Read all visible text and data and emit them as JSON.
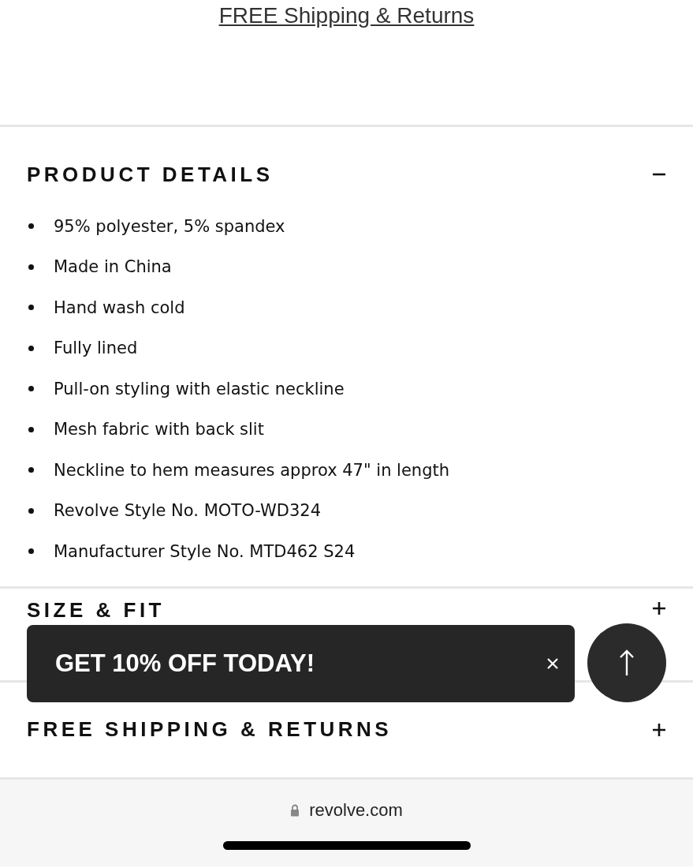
{
  "shipping_link": "FREE Shipping & Returns",
  "sections": [
    {
      "title": "PRODUCT DETAILS",
      "expanded": true,
      "items": [
        "95% polyester, 5% spandex",
        "Made in China",
        "Hand wash cold",
        "Fully lined",
        "Pull-on styling with elastic neckline",
        "Mesh fabric with back slit",
        "Neckline to hem measures approx 47\" in length",
        "Revolve Style No. MOTO-WD324",
        "Manufacturer Style No. MTD462 S24"
      ]
    },
    {
      "title": "SIZE & FIT",
      "expanded": false
    },
    {
      "title": "FREE SHIPPING & RETURNS",
      "expanded": false
    }
  ],
  "promo_banner": {
    "text": "GET 10% OFF TODAY!"
  },
  "browser_bar": {
    "url": "revolve.com"
  }
}
